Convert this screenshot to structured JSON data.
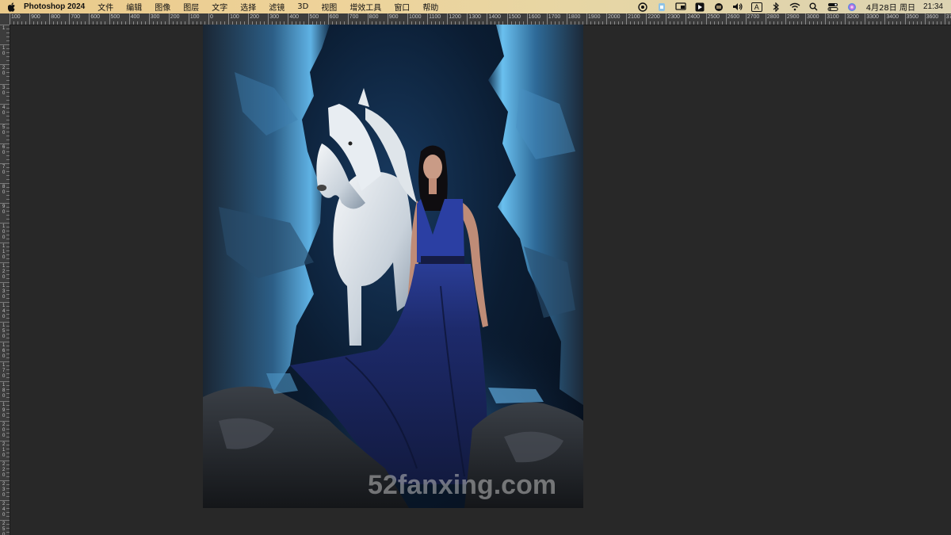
{
  "menubar": {
    "apple_icon": "apple-logo-icon",
    "app_name": "Photoshop 2024",
    "items": [
      "文件",
      "编辑",
      "图像",
      "图层",
      "文字",
      "选择",
      "滤镜",
      "3D",
      "视图",
      "增效工具",
      "窗口",
      "帮助"
    ],
    "status": {
      "icons": [
        "creative-cloud-icon",
        "finder-ext-icon",
        "screen-mirror-icon",
        "media-icon",
        "sync-icon",
        "volume-icon"
      ],
      "input_method": "A",
      "icons2": [
        "bluetooth-icon",
        "wifi-icon",
        "search-icon",
        "control-center-icon",
        "siri-icon"
      ],
      "date": "4月28日 周日",
      "time": "21:34"
    }
  },
  "ruler_top": {
    "labels": [
      "100",
      "900",
      "800",
      "700",
      "600",
      "500",
      "400",
      "300",
      "200",
      "100",
      "0",
      "100",
      "200",
      "300",
      "400",
      "500",
      "600",
      "700",
      "800",
      "900",
      "1000",
      "1100",
      "1200",
      "1300",
      "1400",
      "1500",
      "1600",
      "1700",
      "1800",
      "1900",
      "2000",
      "2100",
      "2200",
      "2300",
      "2400",
      "2500",
      "2600",
      "2700",
      "2800",
      "2900",
      "3000",
      "3100",
      "3200",
      "3300",
      "3400",
      "3500",
      "3600",
      "3700"
    ]
  },
  "ruler_left": {
    "labels": [
      "1",
      "1\n0",
      "2\n0",
      "3\n0",
      "4\n0",
      "5\n0",
      "6\n0",
      "7\n0",
      "8\n0",
      "9\n0",
      "1\n0\n0",
      "1\n1\n0",
      "1\n2\n0",
      "1\n3\n0",
      "1\n4\n0",
      "1\n5\n0",
      "1\n6\n0",
      "1\n7\n0",
      "1\n8\n0",
      "1\n9\n0",
      "2\n0\n0",
      "2\n1\n0",
      "2\n2\n0",
      "2\n3\n0",
      "2\n4\n0",
      "2\n5\n0"
    ]
  },
  "document": {
    "subject": "woman-in-blue-dress-with-white-horse-in-cave",
    "watermark": "52fanxing.com"
  },
  "colors": {
    "menubar": "#e9c98a",
    "workspace": "#282828",
    "ruler": "#3c3c3c",
    "rock_glow": "#4fa3d9",
    "dress": "#1f2f7a"
  }
}
